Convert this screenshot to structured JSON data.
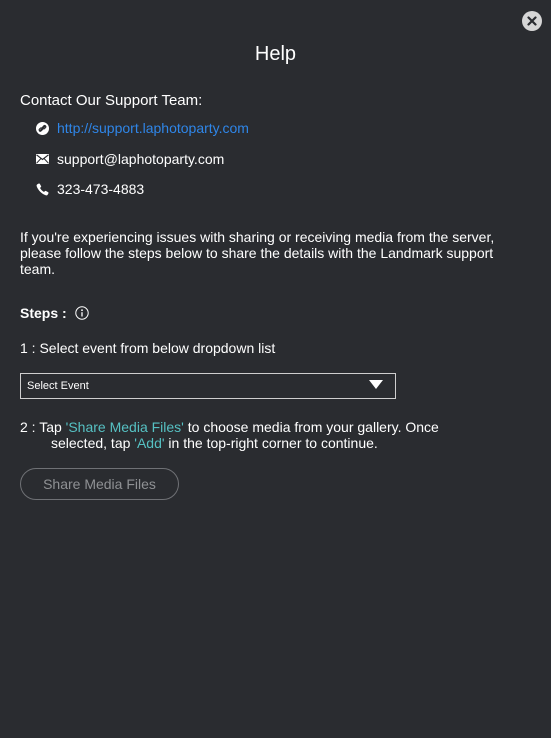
{
  "dialog": {
    "title": "Help",
    "close_icon": "close-circle-icon"
  },
  "contact": {
    "heading": "Contact Our Support Team:",
    "url": "http://support.laphotoparty.com",
    "url_icon": "link-icon",
    "email": "support@laphotoparty.com",
    "email_icon": "envelope-icon",
    "phone": "323-473-4883",
    "phone_icon": "phone-icon",
    "link_color": "#2f86e8"
  },
  "intro": {
    "text": "If you're experiencing issues with sharing or receiving media from the server, please follow the steps below to share the details with the Landmark support team."
  },
  "steps": {
    "heading": "Steps :",
    "info_icon": "info-circle-icon",
    "step1": "1 : Select event from below dropdown list",
    "dropdown": {
      "selected": "Select Event",
      "icon": "caret-down-icon"
    },
    "step2": {
      "prefix": "2 : Tap ",
      "highlight1": "'Share Media Files'",
      "middle": " to choose media from your gallery. Once",
      "line2_prefix": "selected, tap ",
      "highlight2": "'Add'",
      "line2_suffix": " in the top-right corner to continue."
    },
    "share_button": "Share Media Files",
    "highlight_color": "#56c1c3"
  },
  "theme": {
    "background": "#2a2c30",
    "text": "#ffffff"
  }
}
